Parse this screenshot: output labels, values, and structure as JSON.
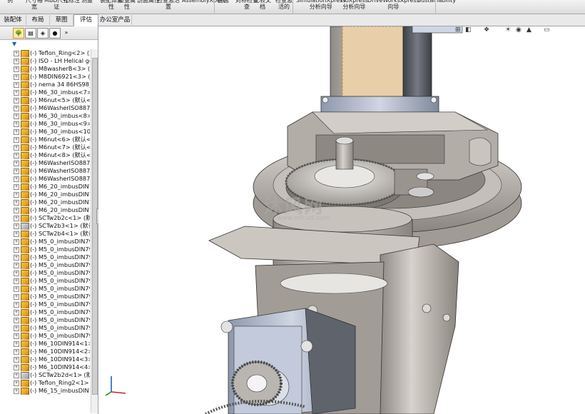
{
  "ribbon": {
    "items": [
      {
        "label": "例",
        "sub": ""
      },
      {
        "label": "尺寸格",
        "sub": "宽"
      },
      {
        "label": "MBD尺寸",
        "sub": "证"
      },
      {
        "label": "孔标注",
        "sub": ""
      },
      {
        "label": "测量",
        "sub": ""
      },
      {
        "label": "装配体属",
        "sub": "性"
      },
      {
        "label": "质量属",
        "sub": "性"
      },
      {
        "label": "剖面属性",
        "sub": ""
      },
      {
        "label": "检查激活",
        "sub": "置"
      },
      {
        "label": "AssemblyXpert",
        "sub": ""
      },
      {
        "label": "曲面",
        "sub": ""
      },
      {
        "label": "对称检查",
        "sub": "查"
      },
      {
        "label": "比较文",
        "sub": "档"
      },
      {
        "label": "检查激",
        "sub": "活的"
      },
      {
        "label": "SimulationXpress",
        "sub": "分析向导"
      },
      {
        "label": "FloXpress",
        "sub": "分析向导"
      },
      {
        "label": "DriveWorksXpress",
        "sub": "向导"
      },
      {
        "label": "Sustainability",
        "sub": ""
      }
    ]
  },
  "tabs": [
    {
      "label": "装配体"
    },
    {
      "label": "布局"
    },
    {
      "label": "草图"
    },
    {
      "label": "评估"
    },
    {
      "label": "办公室产品"
    }
  ],
  "panel": {
    "expand_glyph": "»",
    "tree": [
      "(-) Teflon_Ring<2> (默认",
      "(-) ISO - LH Helical gea",
      "(-) M8washerB<3> (默认",
      "(-) M8DIN6921<3> (默认",
      "(-) nema 34 86HS98_2_",
      "(-) M6_30_imbus<7> (默",
      "(-) M6nut<5> (默认<<默",
      "(-) M6WasherISO887<5",
      "(-) M6_30_imbus<8> (默",
      "(-) M6_30_imbus<9> (默",
      "(-) M6_30_imbus<10> (",
      "(-) M6nut<6> (默认<<默",
      "(-) M6nut<7> (默认<<默",
      "(-) M6nut<8> (默认<<默",
      "(-) M6WasherISO887<6",
      "(-) M6WasherISO887<7",
      "(-) M6WasherISO887<8",
      "(-) M6_20_imbusDIN79",
      "(-) M6_20_imbusDIN79",
      "(-) M6_20_imbusDIN79",
      "(-) M6_20_imbusDIN79",
      "(-) SCTw2b2c<1> (默认",
      "(-) SCTw2b3<1> (默认<",
      "(-) SCTw2b4<1> (默认<",
      "(-) M5_0_imbusDIN7984",
      "(-) M5_0_imbusDIN7984",
      "(-) M5_0_imbusDIN7984",
      "(-) M5_0_imbusDIN7984",
      "(-) M5_0_imbusDIN7984",
      "(-) M5_0_imbusDIN7984",
      "(-) M5_0_imbusDIN7984",
      "(-) M5_0_imbusDIN7984",
      "(-) M5_0_imbusDIN7984",
      "(-) M5_0_imbusDIN7984",
      "(-) M5_0_imbusDIN7984",
      "(-) M5_0_imbusDIN7984",
      "(-) M5_0_imbusDIN7984",
      "(-) M6_10DIN914<1> (默",
      "(-) M6_10DIN914<2> (默",
      "(-) M6_10DIN914<3> (默",
      "(-) M6_10DIN914<4> (默",
      "(-) SCTw2b2d<1> (默认",
      "(-) Teflon_Ring2<1> (默认",
      "(-) M6_15_imbusDIN79"
    ]
  },
  "viewport": {
    "watermark": "沐风网",
    "watermark_url": "www.mfcad.com"
  },
  "colors": {
    "metal_light": "#cfcac4",
    "metal_mid": "#a9a39d",
    "metal_dark": "#6f6a66",
    "motor_blue": "#b9c3d6",
    "motor_dark": "#5a5d66",
    "tan": "#e6c9a3",
    "gear": "#b8b5b1"
  }
}
